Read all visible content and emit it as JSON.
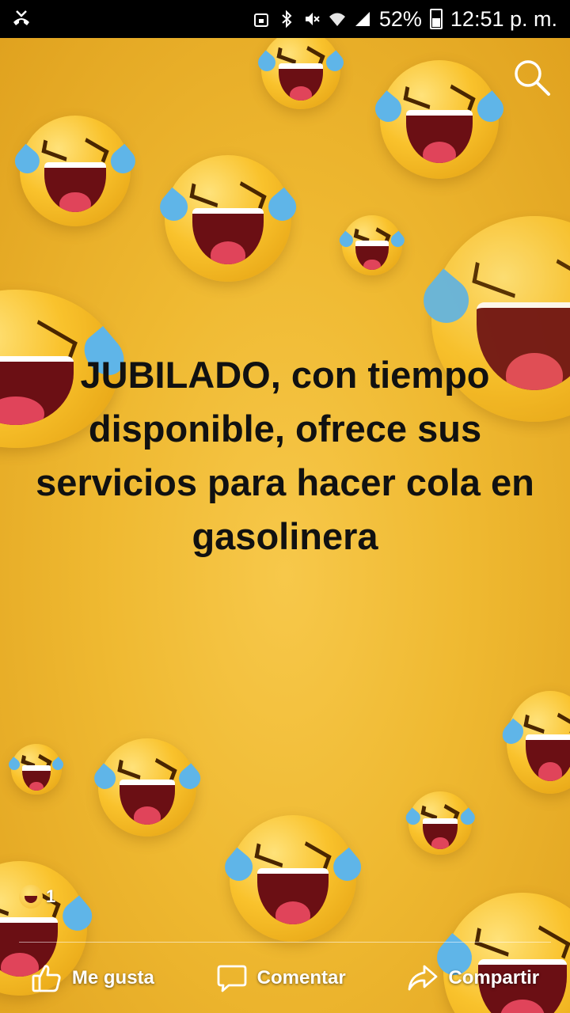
{
  "status_bar": {
    "battery": "52%",
    "time": "12:51 p. m.",
    "icons": [
      "missed-call-icon",
      "lock-image-icon",
      "bluetooth-icon",
      "mute-icon",
      "wifi-icon",
      "signal-icon",
      "battery-icon"
    ]
  },
  "post": {
    "caption": "JUBILADO, con tiempo disponible, ofrece sus servicios para hacer cola en gasolinera",
    "background_color": "#efb931"
  },
  "reactions": {
    "icon": "haha-reaction-icon",
    "count": "1"
  },
  "actions": {
    "like_label": "Me gusta",
    "comment_label": "Comentar",
    "share_label": "Compartir"
  }
}
